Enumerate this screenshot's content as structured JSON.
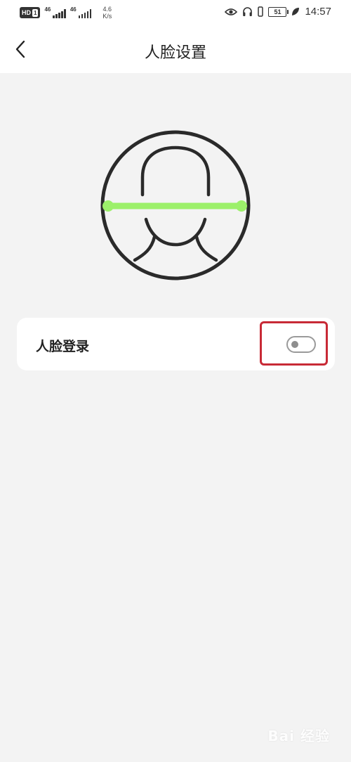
{
  "status_bar": {
    "hd_label": "HD",
    "sim_label": "1",
    "network_1": "46",
    "network_2": "46",
    "speed_value": "4.6",
    "speed_unit": "K/s",
    "battery_level": "51",
    "time": "14:57",
    "icons": [
      "eye-icon",
      "headphones-icon",
      "battery-icon",
      "leaf-icon"
    ]
  },
  "header": {
    "back_icon": "chevron-left-icon",
    "title": "人脸设置"
  },
  "illustration": {
    "icon": "face-scan-icon",
    "scan_line_color": "#9cf06a"
  },
  "settings": {
    "face_login": {
      "label": "人脸登录",
      "enabled": false
    }
  },
  "watermark": {
    "text": "Bai 经验"
  },
  "colors": {
    "background": "#f3f3f3",
    "card": "#ffffff",
    "highlight": "#c82a36"
  }
}
